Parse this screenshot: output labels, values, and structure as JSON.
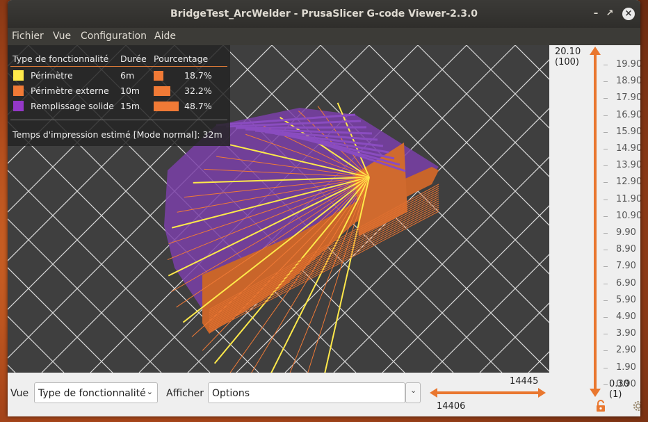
{
  "window": {
    "title": "BridgeTest_ArcWelder - PrusaSlicer G-code Viewer-2.3.0"
  },
  "menu": {
    "items": [
      "Fichier",
      "Vue",
      "Configuration",
      "Aide"
    ]
  },
  "legend": {
    "headers": {
      "type": "Type de fonctionnalité",
      "duration": "Durée",
      "percent": "Pourcentage"
    },
    "rows": [
      {
        "label": "Périmètre",
        "duration": "6m",
        "percent": "18.7%",
        "fraction": 0.187,
        "color": "#ffe94a"
      },
      {
        "label": "Périmètre externe",
        "duration": "10m",
        "percent": "32.2%",
        "fraction": 0.322,
        "color": "#f07a36"
      },
      {
        "label": "Remplissage solide",
        "duration": "15m",
        "percent": "48.7%",
        "fraction": 0.487,
        "color": "#9438c8"
      }
    ],
    "estimate": {
      "label": "Temps d'impression estimé [Mode normal]:",
      "value": "32m"
    }
  },
  "layer_slider": {
    "top_value": "20.10",
    "top_index": "(100)",
    "bottom_value": "0.30",
    "bottom_index": "(1)",
    "ticks": [
      "19.90",
      "18.90",
      "17.90",
      "16.90",
      "15.90",
      "14.90",
      "13.90",
      "12.90",
      "11.90",
      "10.90",
      "9.90",
      "8.90",
      "7.90",
      "6.90",
      "5.90",
      "4.90",
      "3.90",
      "2.90",
      "1.90",
      "0.90"
    ],
    "lock_icon": "lock-icon",
    "settings_icon": "gear-icon"
  },
  "bottom_bar": {
    "view_label": "Vue",
    "view_select": "Type de fonctionnalité",
    "show_label": "Afficher",
    "show_select": "Options",
    "move_top": "14445",
    "move_bottom": "14406"
  },
  "colors": {
    "accent": "#e9772f",
    "perimeter": "#ffe94a",
    "external_perimeter": "#f07a36",
    "solid_infill": "#9438c8"
  }
}
